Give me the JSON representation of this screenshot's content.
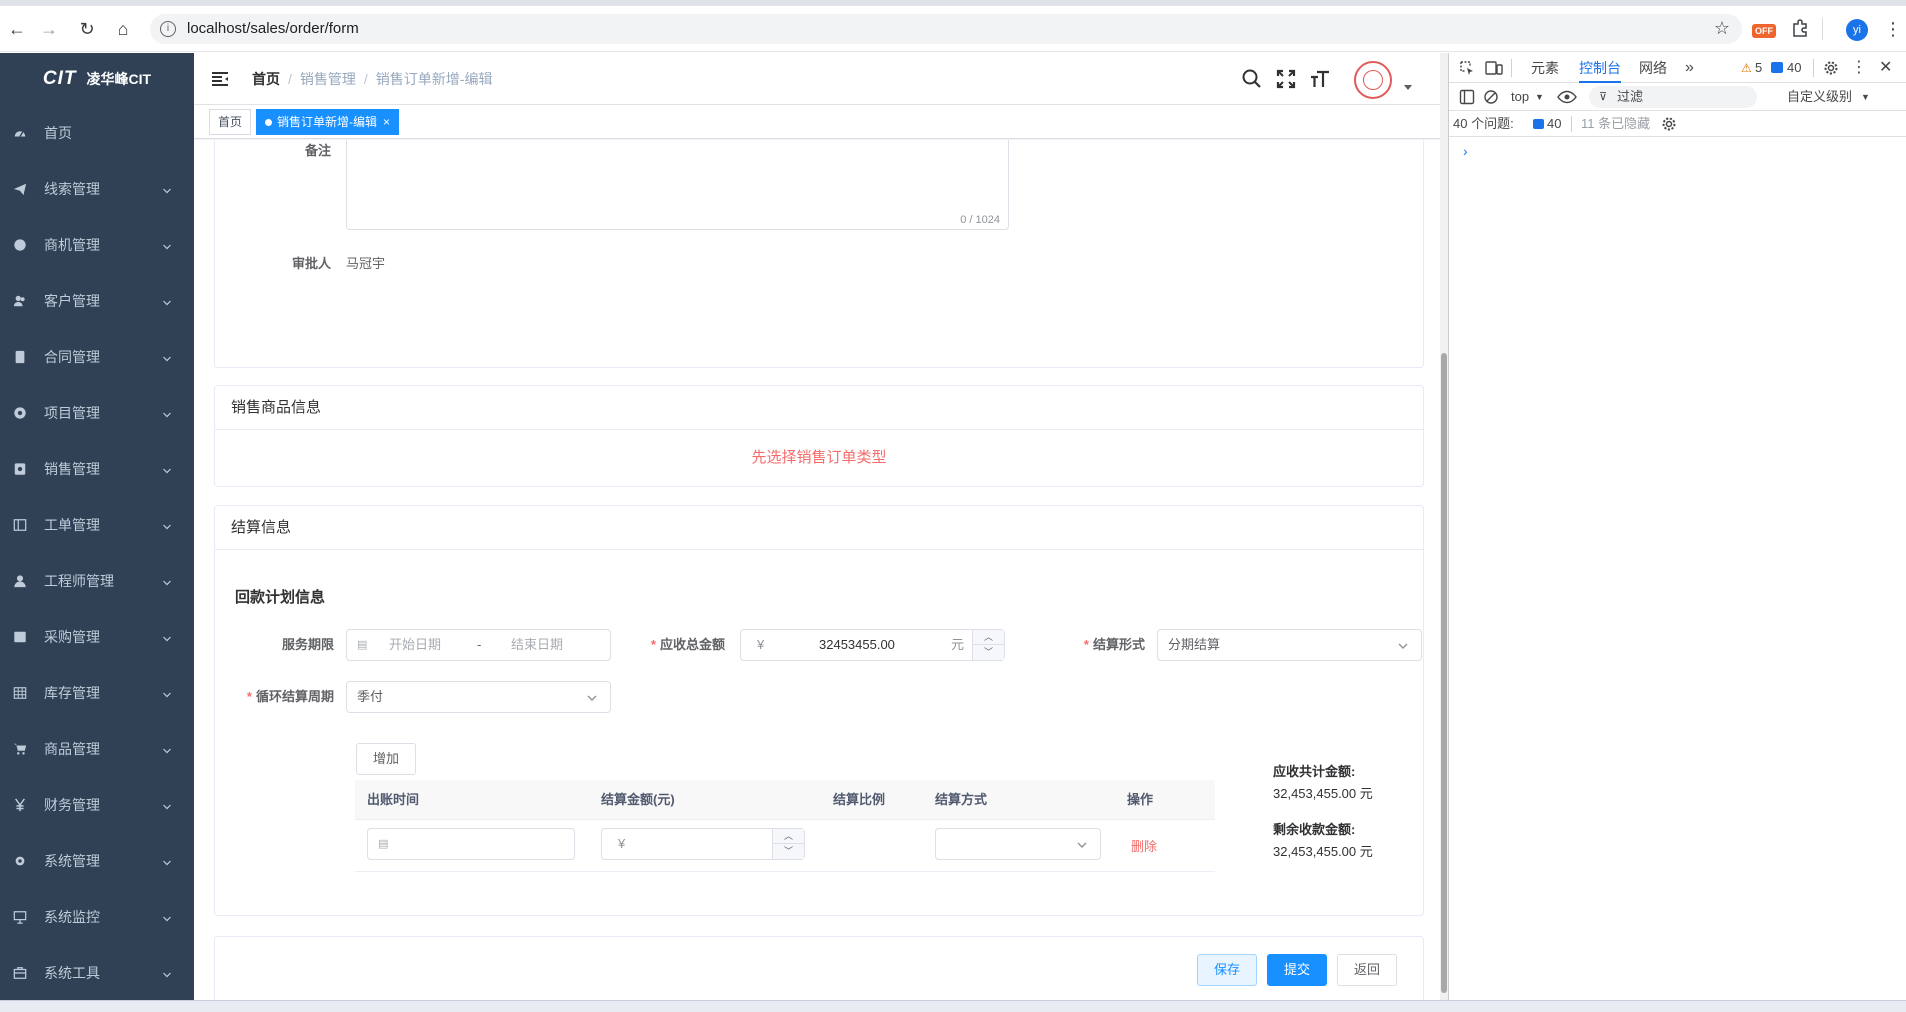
{
  "browser": {
    "url": "localhost/sales/order/form",
    "ext_badge": "OFF",
    "profile_initials": "yi"
  },
  "sidebar": {
    "logo_mark": "CIT",
    "logo_title": "凌华峰CIT",
    "items": [
      {
        "label": "首页",
        "icon": "dashboard-icon",
        "expandable": false
      },
      {
        "label": "线索管理",
        "icon": "send-icon",
        "expandable": true
      },
      {
        "label": "商机管理",
        "icon": "globe-icon",
        "expandable": true
      },
      {
        "label": "客户管理",
        "icon": "peoples-icon",
        "expandable": true
      },
      {
        "label": "合同管理",
        "icon": "contract-icon",
        "expandable": true
      },
      {
        "label": "项目管理",
        "icon": "project-icon",
        "expandable": true
      },
      {
        "label": "销售管理",
        "icon": "sales-icon",
        "expandable": true
      },
      {
        "label": "工单管理",
        "icon": "ticket-icon",
        "expandable": true
      },
      {
        "label": "工程师管理",
        "icon": "user-icon",
        "expandable": true
      },
      {
        "label": "采购管理",
        "icon": "purchase-icon",
        "expandable": true
      },
      {
        "label": "库存管理",
        "icon": "inventory-icon",
        "expandable": true
      },
      {
        "label": "商品管理",
        "icon": "cart-icon",
        "expandable": true
      },
      {
        "label": "财务管理",
        "icon": "yuan-icon",
        "expandable": true
      },
      {
        "label": "系统管理",
        "icon": "gear-icon",
        "expandable": true
      },
      {
        "label": "系统监控",
        "icon": "monitor-icon",
        "expandable": true
      },
      {
        "label": "系统工具",
        "icon": "toolbox-icon",
        "expandable": true
      }
    ]
  },
  "header": {
    "breadcrumb": [
      "首页",
      "销售管理",
      "销售订单新增-编辑"
    ]
  },
  "tags": [
    {
      "label": "首页",
      "active": false
    },
    {
      "label": "销售订单新增-编辑",
      "active": true
    }
  ],
  "form_top": {
    "remark_label": "备注",
    "remark_counter": "0 / 1024",
    "approver_label": "审批人",
    "approver_value": "马冠宇"
  },
  "products_section": {
    "title": "销售商品信息",
    "empty_message": "先选择销售订单类型"
  },
  "settlement_section": {
    "title": "结算信息",
    "subtitle": "回款计划信息",
    "service_period_label": "服务期限",
    "start_placeholder": "开始日期",
    "range_separator": "-",
    "end_placeholder": "结束日期",
    "total_label": "应收总金额",
    "currency_prefix": "¥",
    "total_value": "32453455.00",
    "total_unit": "元",
    "settle_form_label": "结算形式",
    "settle_form_value": "分期结算",
    "cycle_label": "循环结算周期",
    "cycle_value": "季付",
    "add_button": "增加",
    "table_headers": [
      "出账时间",
      "结算金额(元)",
      "结算比例",
      "结算方式",
      "操作"
    ],
    "row_delete": "删除",
    "receivable_total_label": "应收共计金额:",
    "receivable_total_value": "32,453,455.00 元",
    "remaining_label": "剩余收款金额:",
    "remaining_value": "32,453,455.00 元"
  },
  "footer_buttons": {
    "save": "保存",
    "submit": "提交",
    "back": "返回"
  },
  "devtools": {
    "tabs": [
      "元素",
      "控制台",
      "网络"
    ],
    "active_tab": "控制台",
    "warn_count": "5",
    "msg_count": "40",
    "context": "top",
    "filter_placeholder": "过滤",
    "level": "自定义级别",
    "issues_label": "40 个问题:",
    "issues_count": "40",
    "hidden_label": "11 条已隐藏",
    "prompt": "›"
  },
  "colors": {
    "sidebar_bg": "#304156",
    "primary": "#1890ff",
    "danger": "#f56c6c"
  }
}
